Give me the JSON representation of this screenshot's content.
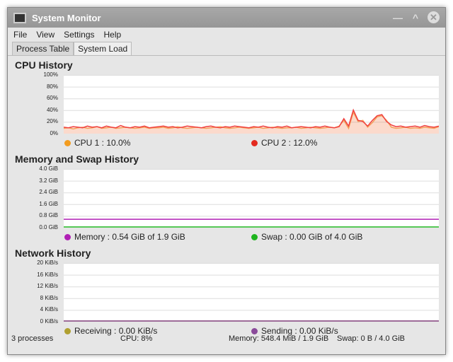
{
  "window": {
    "title": "System Monitor"
  },
  "menu": [
    "File",
    "View",
    "Settings",
    "Help"
  ],
  "tabs": [
    "Process Table",
    "System Load"
  ],
  "cpu": {
    "title": "CPU History",
    "yticks": [
      "100%",
      "80%",
      "60%",
      "40%",
      "20%",
      "0%"
    ],
    "legend": [
      {
        "label": "CPU 1 : 10.0%",
        "color": "#f39c1f"
      },
      {
        "label": "CPU 2 : 12.0%",
        "color": "#e32a1f"
      }
    ]
  },
  "memory": {
    "title": "Memory and Swap History",
    "yticks": [
      "4.0 GiB",
      "3.2 GiB",
      "2.4 GiB",
      "1.6 GiB",
      "0.8 GiB",
      "0.0 GiB"
    ],
    "legend": [
      {
        "label": "Memory : 0.54 GiB of 1.9 GiB",
        "color": "#b01fb5"
      },
      {
        "label": "Swap : 0.00 GiB of 4.0 GiB",
        "color": "#1fb51f"
      }
    ]
  },
  "network": {
    "title": "Network History",
    "yticks": [
      "20 KiB/s",
      "16 KiB/s",
      "12 KiB/s",
      "8 KiB/s",
      "4 KiB/s",
      "0 KiB/s"
    ],
    "legend": [
      {
        "label": "Receiving : 0.00 KiB/s",
        "color": "#b0a030"
      },
      {
        "label": "Sending : 0.00 KiB/s",
        "color": "#8a4a9a"
      }
    ]
  },
  "status": {
    "processes": "3 processes",
    "cpu": "CPU: 8%",
    "memory": "Memory: 548.4 MiB / 1.9 GiB",
    "swap": "Swap: 0 B / 4.0 GiB"
  },
  "chart_data": [
    {
      "type": "line",
      "title": "CPU History",
      "ylim": [
        0,
        100
      ],
      "series": [
        {
          "name": "CPU 1",
          "values": [
            8,
            9,
            7,
            9,
            10,
            8,
            9,
            11,
            8,
            9,
            10,
            8,
            9,
            10,
            9,
            8,
            9,
            10,
            8,
            9,
            9,
            10,
            8,
            9,
            11,
            9,
            8,
            9,
            10,
            9,
            8,
            9,
            10,
            11,
            9,
            8,
            9,
            10,
            9,
            8,
            9,
            10,
            8,
            9,
            10,
            9,
            8,
            9,
            9,
            10,
            8,
            9,
            10,
            9,
            8,
            9,
            10,
            9,
            12,
            22,
            8,
            36,
            20,
            22,
            10,
            18,
            28,
            30,
            22,
            10,
            8,
            9,
            10,
            8,
            9,
            8,
            10,
            9,
            8,
            11
          ]
        },
        {
          "name": "CPU 2",
          "values": [
            10,
            9,
            11,
            10,
            9,
            12,
            10,
            11,
            9,
            12,
            10,
            9,
            13,
            10,
            9,
            11,
            10,
            12,
            9,
            10,
            11,
            12,
            10,
            11,
            9,
            10,
            12,
            11,
            10,
            9,
            11,
            12,
            10,
            9,
            11,
            10,
            12,
            11,
            10,
            9,
            11,
            10,
            12,
            10,
            9,
            11,
            10,
            12,
            9,
            10,
            11,
            10,
            9,
            11,
            10,
            12,
            10,
            9,
            11,
            25,
            12,
            40,
            22,
            20,
            12,
            22,
            30,
            32,
            20,
            14,
            11,
            12,
            10,
            11,
            12,
            10,
            13,
            11,
            10,
            12
          ]
        }
      ]
    },
    {
      "type": "line",
      "title": "Memory and Swap History",
      "ylim": [
        0,
        4.0
      ],
      "series": [
        {
          "name": "Memory",
          "values": [
            0.54,
            0.54
          ]
        },
        {
          "name": "Swap",
          "values": [
            0,
            0
          ]
        }
      ]
    },
    {
      "type": "line",
      "title": "Network History",
      "ylim": [
        0,
        20
      ],
      "series": [
        {
          "name": "Receiving",
          "values": [
            0,
            0
          ]
        },
        {
          "name": "Sending",
          "values": [
            0,
            0
          ]
        }
      ]
    }
  ]
}
